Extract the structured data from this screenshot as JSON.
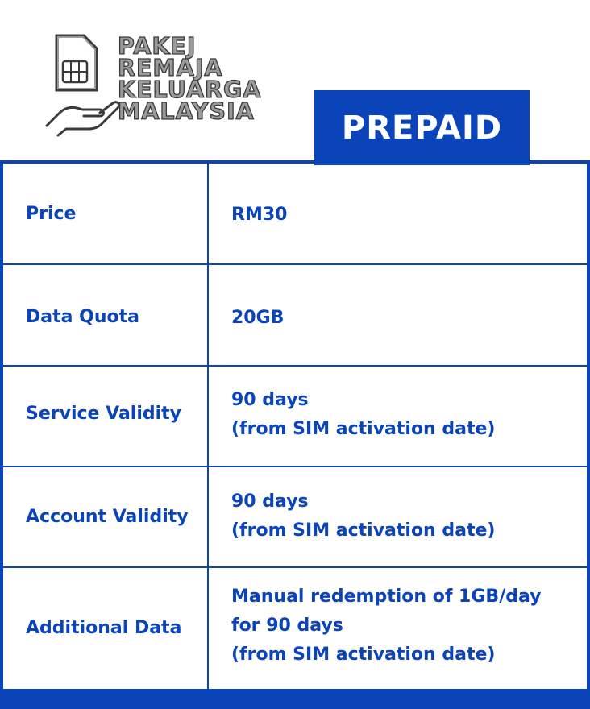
{
  "brand": {
    "lines": [
      "PAKEJ",
      "REMAJA",
      "KELUARGA",
      "MALAYSIA"
    ]
  },
  "tab": {
    "label": "PREPAID"
  },
  "rows": [
    {
      "label": "Price",
      "value": [
        "RM30"
      ]
    },
    {
      "label": "Data Quota",
      "value": [
        "20GB"
      ]
    },
    {
      "label": "Service Validity",
      "value": [
        "90 days",
        "(from SIM activation date)"
      ]
    },
    {
      "label": "Account Validity",
      "value": [
        "90 days",
        "(from SIM activation date)"
      ]
    },
    {
      "label": "Additional Data",
      "value": [
        "Manual redemption of 1GB/day",
        "for 90 days",
        "(from SIM activation date)"
      ]
    }
  ],
  "colors": {
    "accent": "#0a44b8",
    "logo_fill": "#9a9a9a",
    "logo_outline": "#3a3a3a"
  },
  "icons": [
    "sim-card-icon",
    "hand-icon"
  ]
}
